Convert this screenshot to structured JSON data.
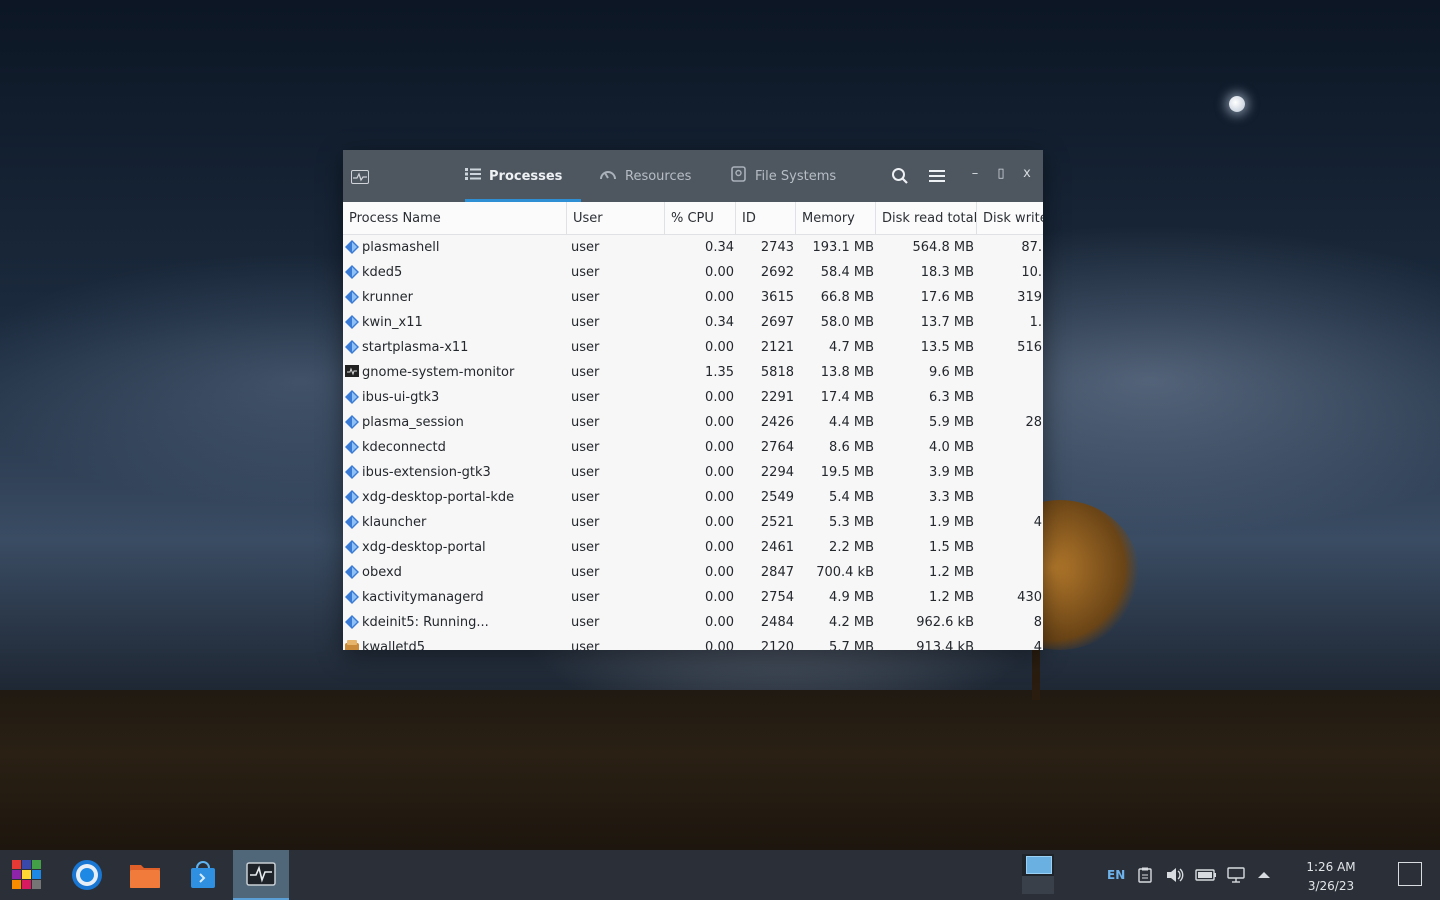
{
  "window": {
    "tabs": [
      {
        "label": "Processes",
        "icon": "list-icon"
      },
      {
        "label": "Resources",
        "icon": "gauge-icon"
      },
      {
        "label": "File Systems",
        "icon": "disk-icon"
      }
    ],
    "controls": {
      "minimize": "–",
      "maximize": "▯",
      "close": "x"
    }
  },
  "columns": [
    "Process Name",
    "User",
    "% CPU",
    "ID",
    "Memory",
    "Disk read total",
    "Disk write"
  ],
  "processes": [
    {
      "name": "plasmashell",
      "user": "user",
      "cpu": "0.34",
      "id": "2743",
      "mem": "193.1 MB",
      "dr": "564.8 MB",
      "dw": "87.",
      "icon": "kde"
    },
    {
      "name": "kded5",
      "user": "user",
      "cpu": "0.00",
      "id": "2692",
      "mem": "58.4 MB",
      "dr": "18.3 MB",
      "dw": "10.",
      "icon": "kde"
    },
    {
      "name": "krunner",
      "user": "user",
      "cpu": "0.00",
      "id": "3615",
      "mem": "66.8 MB",
      "dr": "17.6 MB",
      "dw": "319",
      "icon": "kde"
    },
    {
      "name": "kwin_x11",
      "user": "user",
      "cpu": "0.34",
      "id": "2697",
      "mem": "58.0 MB",
      "dr": "13.7 MB",
      "dw": "1.",
      "icon": "kde"
    },
    {
      "name": "startplasma-x11",
      "user": "user",
      "cpu": "0.00",
      "id": "2121",
      "mem": "4.7 MB",
      "dr": "13.5 MB",
      "dw": "516",
      "icon": "kde"
    },
    {
      "name": "gnome-system-monitor",
      "user": "user",
      "cpu": "1.35",
      "id": "5818",
      "mem": "13.8 MB",
      "dr": "9.6 MB",
      "dw": "",
      "icon": "monitor"
    },
    {
      "name": "ibus-ui-gtk3",
      "user": "user",
      "cpu": "0.00",
      "id": "2291",
      "mem": "17.4 MB",
      "dr": "6.3 MB",
      "dw": "",
      "icon": "kde"
    },
    {
      "name": "plasma_session",
      "user": "user",
      "cpu": "0.00",
      "id": "2426",
      "mem": "4.4 MB",
      "dr": "5.9 MB",
      "dw": "28",
      "icon": "kde"
    },
    {
      "name": "kdeconnectd",
      "user": "user",
      "cpu": "0.00",
      "id": "2764",
      "mem": "8.6 MB",
      "dr": "4.0 MB",
      "dw": "",
      "icon": "kde"
    },
    {
      "name": "ibus-extension-gtk3",
      "user": "user",
      "cpu": "0.00",
      "id": "2294",
      "mem": "19.5 MB",
      "dr": "3.9 MB",
      "dw": "",
      "icon": "kde"
    },
    {
      "name": "xdg-desktop-portal-kde",
      "user": "user",
      "cpu": "0.00",
      "id": "2549",
      "mem": "5.4 MB",
      "dr": "3.3 MB",
      "dw": "",
      "icon": "kde"
    },
    {
      "name": "klauncher",
      "user": "user",
      "cpu": "0.00",
      "id": "2521",
      "mem": "5.3 MB",
      "dr": "1.9 MB",
      "dw": "4",
      "icon": "kde"
    },
    {
      "name": "xdg-desktop-portal",
      "user": "user",
      "cpu": "0.00",
      "id": "2461",
      "mem": "2.2 MB",
      "dr": "1.5 MB",
      "dw": "",
      "icon": "kde"
    },
    {
      "name": "obexd",
      "user": "user",
      "cpu": "0.00",
      "id": "2847",
      "mem": "700.4 kB",
      "dr": "1.2 MB",
      "dw": "",
      "icon": "kde"
    },
    {
      "name": "kactivitymanagerd",
      "user": "user",
      "cpu": "0.00",
      "id": "2754",
      "mem": "4.9 MB",
      "dr": "1.2 MB",
      "dw": "430",
      "icon": "kde"
    },
    {
      "name": "kdeinit5: Running...",
      "user": "user",
      "cpu": "0.00",
      "id": "2484",
      "mem": "4.2 MB",
      "dr": "962.6 kB",
      "dw": "8",
      "icon": "kde"
    },
    {
      "name": "kwalletd5",
      "user": "user",
      "cpu": "0.00",
      "id": "2120",
      "mem": "5.7 MB",
      "dr": "913.4 kB",
      "dw": "4",
      "icon": "wallet"
    }
  ],
  "taskbar": {
    "apps": [
      "start-menu-icon",
      "chrome-icon",
      "files-icon",
      "store-icon",
      "system-monitor-icon"
    ],
    "language": "EN",
    "time": "1:26 AM",
    "date": "3/26/23"
  },
  "colors": {
    "accent": "#2f8fd5",
    "titlebar": "#4e5660",
    "taskbar": "#2b3038",
    "kde_icon": "#3a7bd5"
  }
}
